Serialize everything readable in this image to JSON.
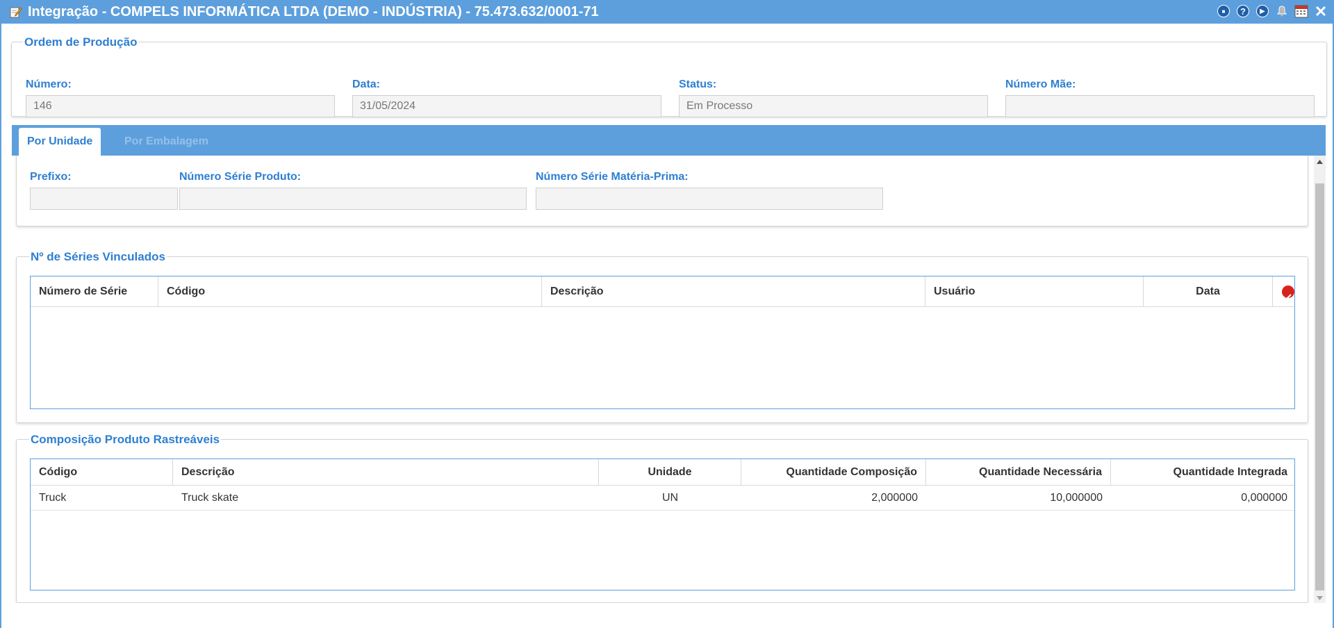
{
  "window": {
    "title": "Integração - COMPELS INFORMÁTICA LTDA (DEMO - INDÚSTRIA) - 75.473.632/0001-71",
    "icons": [
      "edit-icon",
      "record-icon",
      "help-icon",
      "play-icon",
      "bell-icon",
      "calendar-icon",
      "close-icon"
    ],
    "help_glyph": "?"
  },
  "ordem": {
    "legend": "Ordem de Produção",
    "numero_label": "Número:",
    "numero_value": "146",
    "data_label": "Data:",
    "data_value": "31/05/2024",
    "status_label": "Status:",
    "status_value": "Em Processo",
    "numero_mae_label": "Número Mãe:",
    "numero_mae_value": ""
  },
  "tabs": [
    {
      "label": "Por Unidade",
      "active": true
    },
    {
      "label": "Por Embalagem",
      "active": false
    }
  ],
  "serie_form": {
    "prefixo_label": "Prefixo:",
    "prefixo_value": "",
    "serie_produto_label": "Número Série Produto:",
    "serie_produto_value": "",
    "serie_materia_label": "Número Série Matéria-Prima:",
    "serie_materia_value": ""
  },
  "series_vinculados": {
    "legend": "Nº de Séries Vinculados",
    "columns": [
      "Número de Série",
      "Código",
      "Descrição",
      "Usuário",
      "Data"
    ],
    "rows": []
  },
  "composicao": {
    "legend": "Composição Produto Rastreáveis",
    "columns": [
      "Código",
      "Descrição",
      "Unidade",
      "Quantidade Composição",
      "Quantidade Necessária",
      "Quantidade Integrada"
    ],
    "rows": [
      [
        "Truck",
        "Truck skate",
        "UN",
        "2,000000",
        "10,000000",
        "0,000000"
      ]
    ]
  },
  "colors": {
    "accent": "#5d9fdc",
    "label": "#2e7fd1",
    "clear_icon": "#d9221b"
  }
}
